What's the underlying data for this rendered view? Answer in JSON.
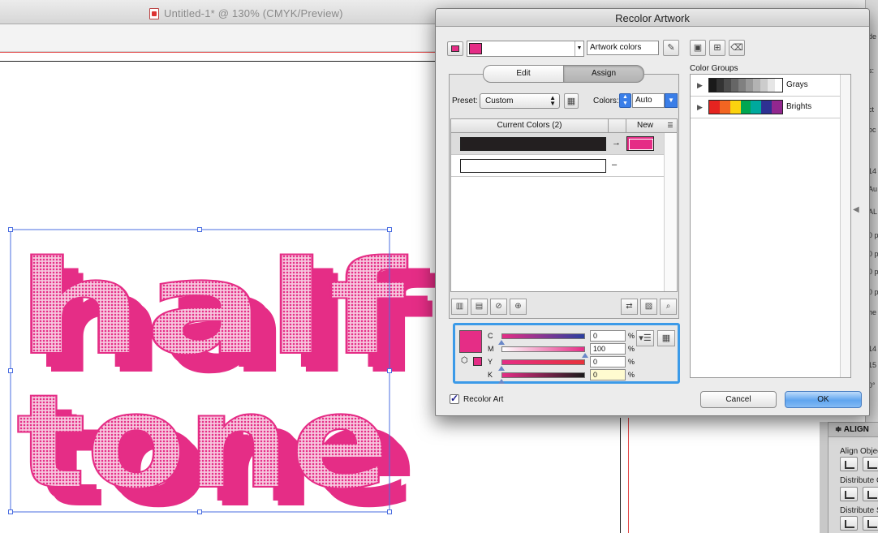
{
  "document": {
    "title": "Untitled-1* @ 130% (CMYK/Preview)",
    "artwork_line1": "half",
    "artwork_line2": "tone",
    "artwork_color": "#e52d86"
  },
  "right_panel": {
    "align_tab": "≑ ALIGN",
    "align_objects": "Align Objec",
    "distribute_objects": "Distribute O",
    "distribute_spacing": "Distribute S",
    "strip_marks": [
      "de",
      "s:",
      "ct",
      "oc",
      "14",
      "Au",
      "AL",
      "0 p",
      "0 p",
      "0 p",
      "0 p",
      "he",
      "14",
      "15",
      "0°"
    ]
  },
  "dialog": {
    "title": "Recolor Artwork",
    "artwork_colors_field": "Artwork colors",
    "tabs": {
      "edit": "Edit",
      "assign": "Assign"
    },
    "preset_label": "Preset:",
    "preset_value": "Custom",
    "colors_label": "Colors:",
    "colors_value": "Auto",
    "table": {
      "current_header": "Current Colors (2)",
      "new_header": "New",
      "rows": [
        {
          "current": "#231f20",
          "mapping": "→",
          "new": "#e52d86"
        },
        {
          "current": "#ffffff",
          "mapping": "–",
          "new": ""
        }
      ]
    },
    "cmyk": {
      "swatch": "#e52d86",
      "sliders": [
        {
          "letter": "C",
          "value": "0",
          "unit": "%",
          "level": 0
        },
        {
          "letter": "M",
          "value": "100",
          "unit": "%",
          "level": 100
        },
        {
          "letter": "Y",
          "value": "0",
          "unit": "%",
          "level": 0
        },
        {
          "letter": "K",
          "value": "0",
          "unit": "%",
          "level": 0
        }
      ]
    },
    "recolor_art_label": "Recolor Art",
    "recolor_art_checked": true,
    "cancel_label": "Cancel",
    "ok_label": "OK",
    "color_groups_label": "Color Groups",
    "groups": [
      {
        "name": "Grays",
        "colors": [
          "#1a1a1a",
          "#333333",
          "#4d4d4d",
          "#666666",
          "#808080",
          "#999999",
          "#b3b3b3",
          "#cccccc",
          "#e6e6e6",
          "#ffffff"
        ]
      },
      {
        "name": "Brights",
        "colors": [
          "#e52420",
          "#f26522",
          "#fbd20f",
          "#00a651",
          "#00a99d",
          "#2e3192",
          "#92278f"
        ]
      }
    ]
  }
}
